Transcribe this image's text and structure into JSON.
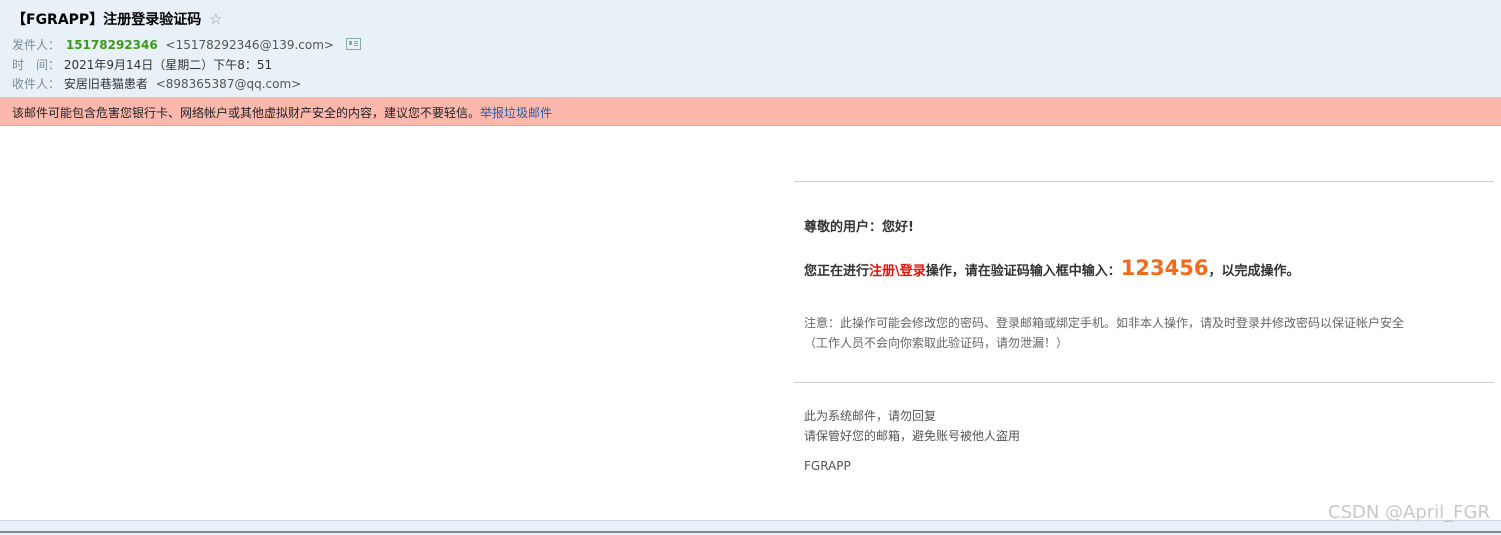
{
  "email": {
    "subject": "【FGRAPP】注册登录验证码",
    "sender_label": "发件人：",
    "sender_name": "15178292346",
    "sender_addr": "<15178292346@139.com>",
    "time_label": "时　间：",
    "time_value": "2021年9月14日（星期二）下午8：51",
    "recipient_label": "收件人：",
    "recipient_name": "安居旧巷猫患者",
    "recipient_addr": "<898365387@qq.com>"
  },
  "warning": {
    "text": "该邮件可能包含危害您银行卡、网络帐户或其他虚拟财产安全的内容，建议您不要轻信。",
    "link": "举报垃圾邮件"
  },
  "body": {
    "greeting": "尊敬的用户：您好!",
    "line_prefix": "您正在进行",
    "line_action": "注册\\登录",
    "line_middle": "操作，请在验证码输入框中输入：",
    "code": "123456",
    "line_suffix": "，以完成操作。",
    "note_line1": "注意：此操作可能会修改您的密码、登录邮箱或绑定手机。如非本人操作，请及时登录并修改密码以保证帐户安全",
    "note_line2": "（工作人员不会向你索取此验证码，请勿泄漏！）",
    "footer_line1": "此为系统邮件，请勿回复",
    "footer_line2": "请保管好您的邮箱，避免账号被他人盗用",
    "signature": "FGRAPP"
  },
  "watermark": "CSDN @April_FGR",
  "icons": {
    "star": "star-icon",
    "contact_card": "contact-card-icon"
  },
  "colors": {
    "header_bg": "#e8f1f8",
    "warning_bg": "#fdb8ae",
    "sender_green": "#3d9a1a",
    "action_red": "#e3120b",
    "code_orange": "#f26a1b",
    "link_blue": "#1f5fa8"
  }
}
